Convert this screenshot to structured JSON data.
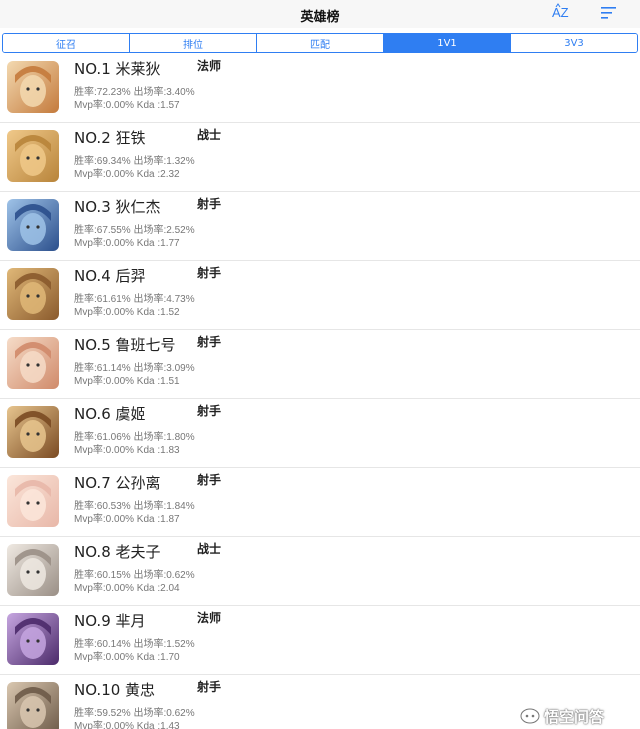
{
  "header": {
    "title": "英雄榜",
    "az_label": "AZ"
  },
  "tabs": [
    {
      "label": "征召",
      "active": false
    },
    {
      "label": "排位",
      "active": false
    },
    {
      "label": "匹配",
      "active": false
    },
    {
      "label": "1V1",
      "active": true
    },
    {
      "label": "3V3",
      "active": false
    }
  ],
  "heroes": [
    {
      "rank_name": "NO.1 米莱狄",
      "role": "法师",
      "stats1": "胜率:72.23% 出场率:3.40%",
      "stats2": "Mvp率:0.00% Kda :1.57"
    },
    {
      "rank_name": "NO.2 狂铁",
      "role": "战士",
      "stats1": "胜率:69.34% 出场率:1.32%",
      "stats2": "Mvp率:0.00% Kda :2.32"
    },
    {
      "rank_name": "NO.3 狄仁杰",
      "role": "射手",
      "stats1": "胜率:67.55% 出场率:2.52%",
      "stats2": "Mvp率:0.00% Kda :1.77"
    },
    {
      "rank_name": "NO.4 后羿",
      "role": "射手",
      "stats1": "胜率:61.61% 出场率:4.73%",
      "stats2": "Mvp率:0.00% Kda :1.52"
    },
    {
      "rank_name": "NO.5 鲁班七号",
      "role": "射手",
      "stats1": "胜率:61.14% 出场率:3.09%",
      "stats2": "Mvp率:0.00% Kda :1.51"
    },
    {
      "rank_name": "NO.6 虞姬",
      "role": "射手",
      "stats1": "胜率:61.06% 出场率:1.80%",
      "stats2": "Mvp率:0.00% Kda :1.83"
    },
    {
      "rank_name": "NO.7 公孙离",
      "role": "射手",
      "stats1": "胜率:60.53% 出场率:1.84%",
      "stats2": "Mvp率:0.00% Kda :1.87"
    },
    {
      "rank_name": "NO.8 老夫子",
      "role": "战士",
      "stats1": "胜率:60.15% 出场率:0.62%",
      "stats2": "Mvp率:0.00% Kda :2.04"
    },
    {
      "rank_name": "NO.9 芈月",
      "role": "法师",
      "stats1": "胜率:60.14% 出场率:1.52%",
      "stats2": "Mvp率:0.00% Kda :1.70"
    },
    {
      "rank_name": "NO.10 黄忠",
      "role": "射手",
      "stats1": "胜率:59.52% 出场率:0.62%",
      "stats2": "Mvp率:0.00% Kda :1.43"
    }
  ],
  "avatar_colors": [
    [
      "#c47a3c",
      "#f3d9b0"
    ],
    [
      "#b8843a",
      "#f0c98a"
    ],
    [
      "#2b4f8c",
      "#9fc3e8"
    ],
    [
      "#8a5a2c",
      "#e0b878"
    ],
    [
      "#d08a6a",
      "#f6dcc8"
    ],
    [
      "#7a4a22",
      "#e7c58e"
    ],
    [
      "#e8b7a8",
      "#fbe6da"
    ],
    [
      "#9a8f86",
      "#efe9e2"
    ],
    [
      "#4b2a6a",
      "#c6a6e0"
    ],
    [
      "#6d5a48",
      "#d9c7b0"
    ]
  ],
  "watermark": {
    "text": "悟空问答"
  }
}
